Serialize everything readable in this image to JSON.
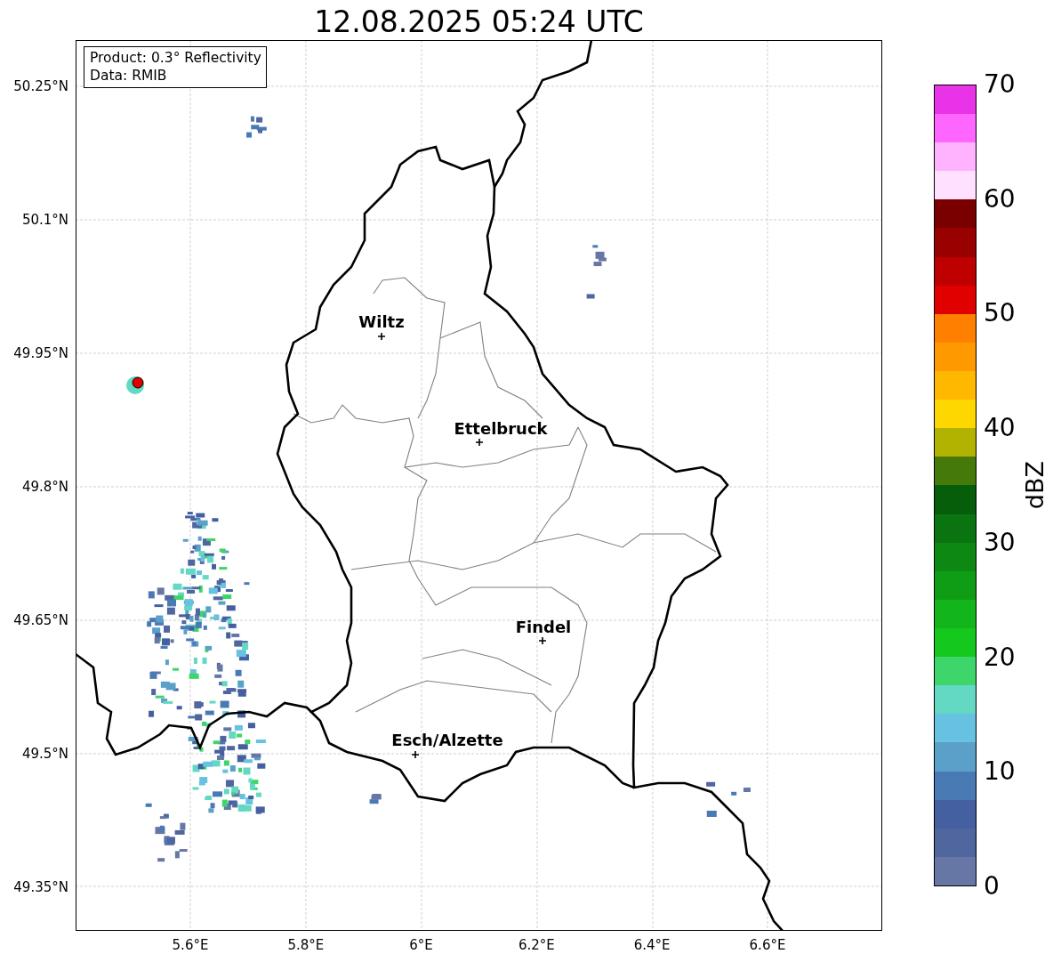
{
  "title": "12.08.2025 05:24 UTC",
  "info_box": {
    "lines": [
      "Product: 0.3° Reflectivity",
      "Data: RMIB"
    ]
  },
  "map": {
    "y_ticks": [
      "50.25°N",
      "50.1°N",
      "49.95°N",
      "49.8°N",
      "49.65°N",
      "49.5°N",
      "49.35°N"
    ],
    "x_ticks": [
      "5.6°E",
      "5.8°E",
      "6°E",
      "6.2°E",
      "6.4°E",
      "6.6°E"
    ],
    "cities": [
      {
        "name": "Wiltz"
      },
      {
        "name": "Ettelbruck"
      },
      {
        "name": "Findel"
      },
      {
        "name": "Esch/Alzette"
      }
    ]
  },
  "colorbar": {
    "label": "dBZ",
    "ticks": [
      "70",
      "60",
      "50",
      "40",
      "30",
      "20",
      "10",
      "0"
    ],
    "bins": [
      {
        "color": "#6677a5"
      },
      {
        "color": "#50669e"
      },
      {
        "color": "#4460a0"
      },
      {
        "color": "#4a7ab4"
      },
      {
        "color": "#5aa0c8"
      },
      {
        "color": "#66c2e0"
      },
      {
        "color": "#63d8c3"
      },
      {
        "color": "#3ed56a"
      },
      {
        "color": "#14c81e"
      },
      {
        "color": "#12b51a"
      },
      {
        "color": "#0f9d15"
      },
      {
        "color": "#0c8813"
      },
      {
        "color": "#0a7510"
      },
      {
        "color": "#065d0a"
      },
      {
        "color": "#457a0b"
      },
      {
        "color": "#b2b200"
      },
      {
        "color": "#ffd700"
      },
      {
        "color": "#ffb700"
      },
      {
        "color": "#ff9900"
      },
      {
        "color": "#ff7f00"
      },
      {
        "color": "#e00000"
      },
      {
        "color": "#bf0000"
      },
      {
        "color": "#990000"
      },
      {
        "color": "#7a0000"
      },
      {
        "color": "#ffe0ff"
      },
      {
        "color": "#ffb3ff"
      },
      {
        "color": "#ff66ff"
      },
      {
        "color": "#e833e8"
      }
    ]
  }
}
